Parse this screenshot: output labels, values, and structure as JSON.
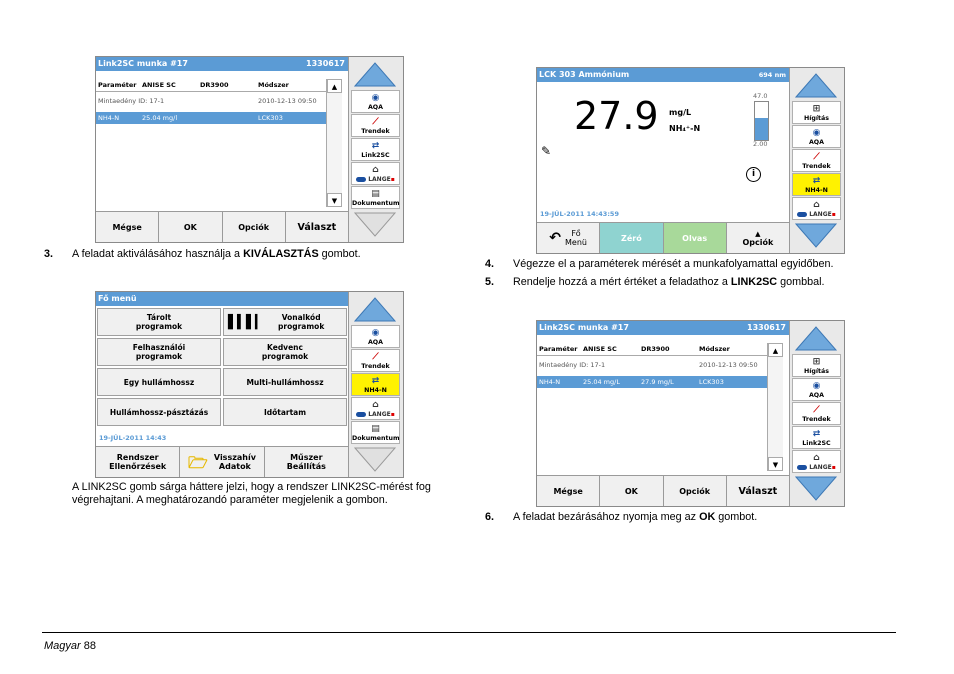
{
  "screen1": {
    "title": "Link2SC munka   #17",
    "title_id": "1330617",
    "header": {
      "c1": "Paraméter",
      "c2": "ANISE SC",
      "c3": "DR3900",
      "c4": "Módszer"
    },
    "rows": [
      {
        "c1": "Mintaedény ID: 17-1",
        "c2": "",
        "c3": "",
        "c4": "2010-12-13 09:50"
      },
      {
        "c1": "NH4-N",
        "c2": "25.04 mg/l",
        "c3": "",
        "c4": "LCK303"
      }
    ],
    "scroll_up": "▲",
    "scroll_down": "▼",
    "sidebar": [
      "AQA",
      "Trendek",
      "Link2SC",
      "",
      "Dokumentum"
    ],
    "footer": [
      "Mégse",
      "OK",
      "Opciók",
      "Választ"
    ]
  },
  "caption3": {
    "num": "3.",
    "pre": "A feladat aktiválásához használja a ",
    "bold": "KIVÁLASZTÁS",
    "post": " gombot."
  },
  "screen2": {
    "title": "Fő menü",
    "buttons": [
      [
        "Tárolt",
        "programok"
      ],
      [
        "Vonalkód",
        "programok"
      ],
      [
        "Felhasználói",
        "programok"
      ],
      [
        "Kedvenc",
        "programok"
      ],
      [
        "Egy hullámhossz",
        ""
      ],
      [
        "Multi-hullámhossz",
        ""
      ],
      [
        "Hullámhossz-pásztázás",
        ""
      ],
      [
        "Időtartam",
        ""
      ]
    ],
    "datetime": "19-JÚL-2011  14:43",
    "sidebar": [
      "AQA",
      "Trendek",
      "NH4-N",
      "",
      "Dokumentum"
    ],
    "footer": [
      [
        "Rendszer",
        "Ellenőrzések"
      ],
      [
        "Visszahív",
        "Adatok"
      ],
      [
        "Műszer",
        "Beállítás"
      ]
    ]
  },
  "caption_note": "A LINK2SC gomb sárga háttere jelzi, hogy a rendszer LINK2SC-mérést fog végrehajtani. A meghatározandó paraméter megjelenik a gombon.",
  "screen3": {
    "title": "LCK 303 Ammónium",
    "wavelength": "694 nm",
    "value": "27.9",
    "unit": "mg/L",
    "param": "NH₄⁺-N",
    "range_max": "47.0",
    "range_min": "2.00",
    "level": 0.59,
    "datetime": "19-JÚL-2011  14:43:59",
    "sidebar": [
      "Hígítás",
      "AQA",
      "Trendek",
      "NH4-N",
      ""
    ],
    "footer": [
      [
        "Fő",
        "Menü"
      ],
      [
        "Zéró",
        ""
      ],
      [
        "Olvas",
        ""
      ],
      [
        "Opciók",
        ""
      ]
    ]
  },
  "caption4": {
    "num": "4.",
    "text": "Végezze el a paraméterek mérését a munkafolyamattal egyidőben."
  },
  "caption5": {
    "num": "5.",
    "pre": "Rendelje hozzá a mért értéket a feladathoz a ",
    "bold": "LINK2SC",
    "post": " gombbal."
  },
  "screen4": {
    "title": "Link2SC munka   #17",
    "title_id": "1330617",
    "header": {
      "c1": "Paraméter",
      "c2": "ANISE SC",
      "c3": "DR3900",
      "c4": "Módszer"
    },
    "rows": [
      {
        "c1": "Mintaedény ID: 17-1",
        "c2": "",
        "c3": "",
        "c4": "2010-12-13 09:50"
      },
      {
        "c1": "NH4-N",
        "c2": "25.04 mg/L",
        "c3": "27.9 mg/L",
        "c4": "LCK303"
      }
    ],
    "sidebar": [
      "Hígítás",
      "AQA",
      "Trendek",
      "Link2SC",
      ""
    ],
    "footer": [
      "Mégse",
      "OK",
      "Opciók",
      "Választ"
    ]
  },
  "caption6": {
    "num": "6.",
    "pre": "A feladat bezárásához nyomja meg az ",
    "bold": "OK",
    "post": " gombot."
  },
  "footer": {
    "lang": "Magyar",
    "page": "88"
  },
  "colors": {
    "title_bar": "#5b9bd5",
    "selection": "#5b9bd5",
    "highlight": "#fff200",
    "zero_btn": "#8fd3d0",
    "read_btn": "#a8d99a"
  }
}
